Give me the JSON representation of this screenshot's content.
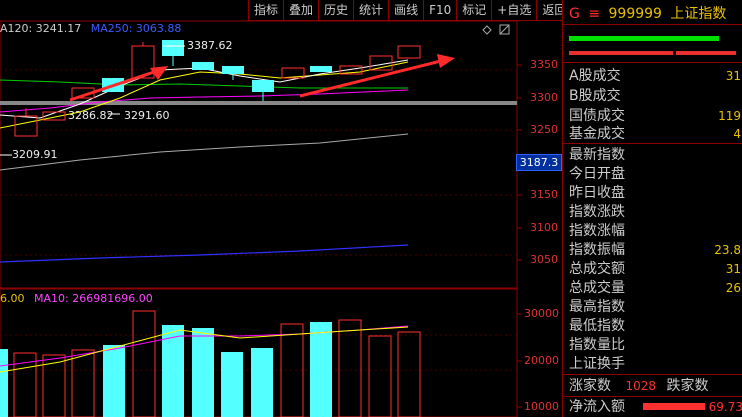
{
  "toolbar": {
    "buttons": [
      "指标",
      "叠加",
      "历史",
      "统计",
      "画线",
      "F10",
      "标记",
      "+自选",
      "返回"
    ]
  },
  "ma_legend": {
    "ma120": "A120: 3241.17",
    "ma250": "MA250: 3063.88"
  },
  "annotations": {
    "high": "3387.62",
    "mid": "3286.82",
    "mid2": "3291.60",
    "low": "3209.91"
  },
  "price_axis": {
    "labels": [
      "3350",
      "3300",
      "3250",
      "3150",
      "3100",
      "3050"
    ],
    "current": "3187.3"
  },
  "vol_legend": {
    "ma5": "6.00",
    "ma10": "MA10: 266981696.00"
  },
  "vol_axis": {
    "labels": [
      "30000",
      "20000",
      "10000"
    ]
  },
  "header": {
    "g": "G",
    "menu": "≡",
    "code": "999999",
    "name": "上证指数"
  },
  "stats": {
    "rows": [
      {
        "label": "A股成交",
        "value": "31"
      },
      {
        "label": "B股成交",
        "value": ""
      },
      {
        "label": "国债成交",
        "value": "119"
      },
      {
        "label": "基金成交",
        "value": "4"
      },
      {
        "label": "最新指数",
        "value": ""
      },
      {
        "label": "今日开盘",
        "value": ""
      },
      {
        "label": "昨日收盘",
        "value": ""
      },
      {
        "label": "指数涨跌",
        "value": ""
      },
      {
        "label": "指数涨幅",
        "value": ""
      },
      {
        "label": "指数振幅",
        "value": "23.8"
      },
      {
        "label": "总成交额",
        "value": "31"
      },
      {
        "label": "总成交量",
        "value": "26"
      },
      {
        "label": "最高指数",
        "value": ""
      },
      {
        "label": "最低指数",
        "value": ""
      },
      {
        "label": "指数量比",
        "value": ""
      },
      {
        "label": "上证换手",
        "value": ""
      }
    ]
  },
  "footer": {
    "up_label": "涨家数",
    "up_value": "1028",
    "down_label": "跌家数",
    "net_label": "净流入额",
    "net_value": "69.73"
  },
  "colors": {
    "up": "#ff3030",
    "down": "#54ffff",
    "grid": "#8b0000",
    "ma5": "#ffffff",
    "ma10": "#ffff00",
    "ma20": "#ff00ff",
    "ma60": "#00cc00",
    "ma120": "#aaaaaa",
    "ma250": "#3030ff"
  }
}
